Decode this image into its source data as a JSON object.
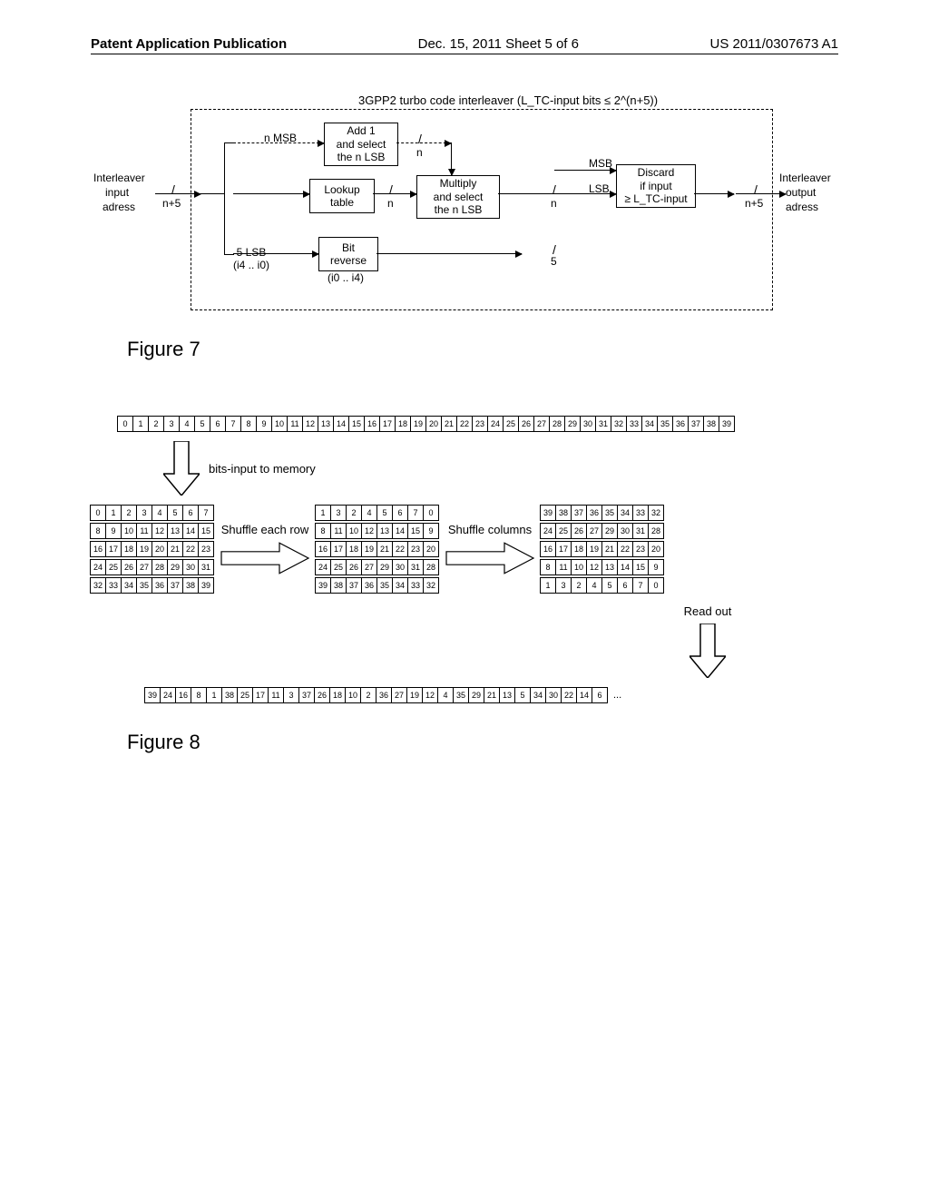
{
  "header": {
    "left": "Patent Application Publication",
    "mid": "Dec. 15, 2011  Sheet 5 of 6",
    "right": "US 2011/0307673 A1"
  },
  "fig7": {
    "title": "Figure 7",
    "caption": "3GPP2 turbo code interleaver (L_TC-input bits ≤ 2^(n+5))",
    "left_in_top": "Interleaver",
    "left_in_mid": "input",
    "left_in_bot": "adress",
    "right_out_top": "Interleaver",
    "right_out_mid": "output",
    "right_out_bot": "adress",
    "nmsb": "n MSB",
    "add1": "Add 1\nand select\nthe n LSB",
    "lookup": "Lookup\ntable",
    "mult": "Multiply\nand select\nthe n LSB",
    "discard": "Discard\nif input\n≥ L_TC-input",
    "bitrev": "Bit\nreverse",
    "lsb5": "5 LSB\n(i4 .. i0)",
    "rev_out": "(i0 .. i4)",
    "msb": "MSB",
    "lsb": "LSB",
    "bus_n5": "n+5",
    "bus_n": "n",
    "bus_5": "5"
  },
  "fig8": {
    "title": "Figure 8",
    "lbl_input": "bits-input to memory",
    "lbl_shuffle_row": "Shuffle each row",
    "lbl_shuffle_col": "Shuffle columns",
    "lbl_readout": "Read out",
    "topstrip": [
      "0",
      "1",
      "2",
      "3",
      "4",
      "5",
      "6",
      "7",
      "8",
      "9",
      "10",
      "11",
      "12",
      "13",
      "14",
      "15",
      "16",
      "17",
      "18",
      "19",
      "20",
      "21",
      "22",
      "23",
      "24",
      "25",
      "26",
      "27",
      "28",
      "29",
      "30",
      "31",
      "32",
      "33",
      "34",
      "35",
      "36",
      "37",
      "38",
      "39"
    ],
    "matrix1": [
      [
        "0",
        "1",
        "2",
        "3",
        "4",
        "5",
        "6",
        "7"
      ],
      [
        "8",
        "9",
        "10",
        "11",
        "12",
        "13",
        "14",
        "15"
      ],
      [
        "16",
        "17",
        "18",
        "19",
        "20",
        "21",
        "22",
        "23"
      ],
      [
        "24",
        "25",
        "26",
        "27",
        "28",
        "29",
        "30",
        "31"
      ],
      [
        "32",
        "33",
        "34",
        "35",
        "36",
        "37",
        "38",
        "39"
      ]
    ],
    "matrix2": [
      [
        "1",
        "3",
        "2",
        "4",
        "5",
        "6",
        "7",
        "0"
      ],
      [
        "8",
        "11",
        "10",
        "12",
        "13",
        "14",
        "15",
        "9"
      ],
      [
        "16",
        "17",
        "18",
        "19",
        "21",
        "22",
        "23",
        "20"
      ],
      [
        "24",
        "25",
        "26",
        "27",
        "29",
        "30",
        "31",
        "28"
      ],
      [
        "39",
        "38",
        "37",
        "36",
        "35",
        "34",
        "33",
        "32"
      ]
    ],
    "matrix3": [
      [
        "39",
        "38",
        "37",
        "36",
        "35",
        "34",
        "33",
        "32"
      ],
      [
        "24",
        "25",
        "26",
        "27",
        "29",
        "30",
        "31",
        "28"
      ],
      [
        "16",
        "17",
        "18",
        "19",
        "21",
        "22",
        "23",
        "20"
      ],
      [
        "8",
        "11",
        "10",
        "12",
        "13",
        "14",
        "15",
        "9"
      ],
      [
        "1",
        "3",
        "2",
        "4",
        "5",
        "6",
        "7",
        "0"
      ]
    ],
    "output": [
      "39",
      "24",
      "16",
      "8",
      "1",
      "38",
      "25",
      "17",
      "11",
      "3",
      "37",
      "26",
      "18",
      "10",
      "2",
      "36",
      "27",
      "19",
      "12",
      "4",
      "35",
      "29",
      "21",
      "13",
      "5",
      "34",
      "30",
      "22",
      "14",
      "6"
    ],
    "ellipsis": "..."
  }
}
